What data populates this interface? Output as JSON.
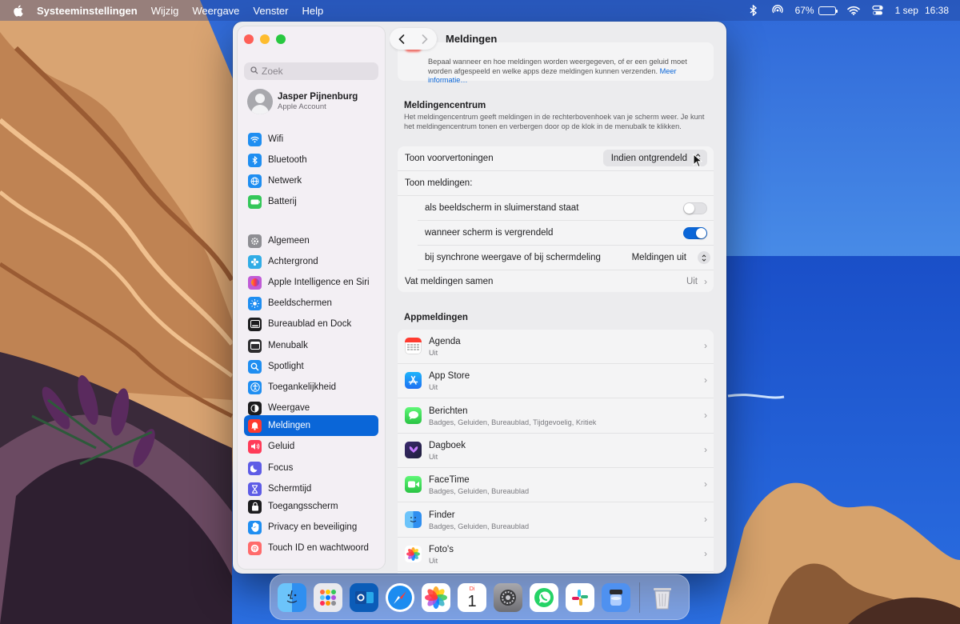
{
  "menubar": {
    "app_name": "Systeeminstellingen",
    "menus": [
      "Wijzig",
      "Weergave",
      "Venster",
      "Help"
    ],
    "battery_percent": "67%",
    "battery_level": 0.67,
    "date": "1 sep",
    "time": "16:38"
  },
  "sidebar": {
    "search_placeholder": "Zoek",
    "account": {
      "name": "Jasper Pijnenburg",
      "subtitle": "Apple Account"
    },
    "items": [
      {
        "label": "Wifi",
        "icon": "wifi-icon",
        "color": "#1f8ef1"
      },
      {
        "label": "Bluetooth",
        "icon": "bluetooth-icon",
        "color": "#1f8ef1"
      },
      {
        "label": "Netwerk",
        "icon": "globe-icon",
        "color": "#1f8ef1"
      },
      {
        "label": "Batterij",
        "icon": "battery-icon",
        "color": "#34c759"
      },
      {
        "label": "Algemeen",
        "icon": "gear-icon",
        "color": "#8e8e93"
      },
      {
        "label": "Achtergrond",
        "icon": "flower-icon",
        "color": "#32ade6"
      },
      {
        "label": "Apple Intelligence en Siri",
        "icon": "siri-icon",
        "color": "#c05bd6"
      },
      {
        "label": "Beeldschermen",
        "icon": "sun-icon",
        "color": "#1f8ef1"
      },
      {
        "label": "Bureaublad en Dock",
        "icon": "dock-icon",
        "color": "#1c1c1e"
      },
      {
        "label": "Menubalk",
        "icon": "menubar-icon",
        "color": "#2c2c2e"
      },
      {
        "label": "Spotlight",
        "icon": "magnifier-icon",
        "color": "#1f8ef1"
      },
      {
        "label": "Toegankelijkheid",
        "icon": "accessibility-icon",
        "color": "#1f8ef1"
      },
      {
        "label": "Weergave",
        "icon": "appearance-icon",
        "color": "#1c1c1e"
      },
      {
        "label": "Meldingen",
        "icon": "bell-icon",
        "color": "#ff3b30"
      },
      {
        "label": "Geluid",
        "icon": "speaker-icon",
        "color": "#ff3b58"
      },
      {
        "label": "Focus",
        "icon": "moon-icon",
        "color": "#5e5ce6"
      },
      {
        "label": "Schermtijd",
        "icon": "hourglass-icon",
        "color": "#5e5ce6"
      },
      {
        "label": "Toegangsscherm",
        "icon": "lock-icon",
        "color": "#1c1c1e"
      },
      {
        "label": "Privacy en beveiliging",
        "icon": "hand-icon",
        "color": "#1f8ef1"
      },
      {
        "label": "Touch ID en wachtwoord",
        "icon": "fingerprint-icon",
        "color": "#ff6b6b"
      }
    ],
    "active_index": 13
  },
  "content": {
    "title": "Meldingen",
    "top_desc": "Bepaal wanneer en hoe meldingen worden weergegeven, of er een geluid moet worden afgespeeld en welke apps deze meldingen kunnen verzenden.",
    "top_link": "Meer informatie…",
    "center_title": "Meldingencentrum",
    "center_desc": "Het meldingencentrum geeft meldingen in de rechterbovenhoek van je scherm weer. Je kunt het meldingencentrum tonen en verbergen door op de klok in de menubalk te klikken.",
    "previews_label": "Toon voorvertoningen",
    "previews_value": "Indien ontgrendeld",
    "show_label": "Toon meldingen:",
    "sleep_label": "als beeldscherm in sluimerstand staat",
    "sleep_on": false,
    "locked_label": "wanneer scherm is vergrendeld",
    "locked_on": true,
    "mirror_label": "bij synchrone weergave of bij schermdeling",
    "mirror_value": "Meldingen uit",
    "summary_label": "Vat meldingen samen",
    "summary_value": "Uit",
    "apps_title": "Appmeldingen",
    "apps": [
      {
        "name": "Agenda",
        "sub": "Uit",
        "icon": "calendar-icon"
      },
      {
        "name": "App Store",
        "sub": "Uit",
        "icon": "appstore-icon"
      },
      {
        "name": "Berichten",
        "sub": "Badges, Geluiden, Bureaublad, Tijdgevoelig, Kritiek",
        "icon": "messages-icon"
      },
      {
        "name": "Dagboek",
        "sub": "Uit",
        "icon": "journal-icon"
      },
      {
        "name": "FaceTime",
        "sub": "Badges, Geluiden, Bureaublad",
        "icon": "facetime-icon"
      },
      {
        "name": "Finder",
        "sub": "Badges, Geluiden, Bureaublad",
        "icon": "finder-icon"
      },
      {
        "name": "Foto's",
        "sub": "Uit",
        "icon": "photos-icon"
      }
    ]
  },
  "dock": {
    "apps": [
      "finder-icon",
      "launchpad-icon",
      "outlook-icon",
      "safari-icon",
      "photos-icon",
      "calendar-icon",
      "settings-icon",
      "whatsapp-icon",
      "slack-icon",
      "preview-icon"
    ],
    "calendar_day": "Di",
    "calendar_date": "1",
    "trash": "trash-icon"
  }
}
